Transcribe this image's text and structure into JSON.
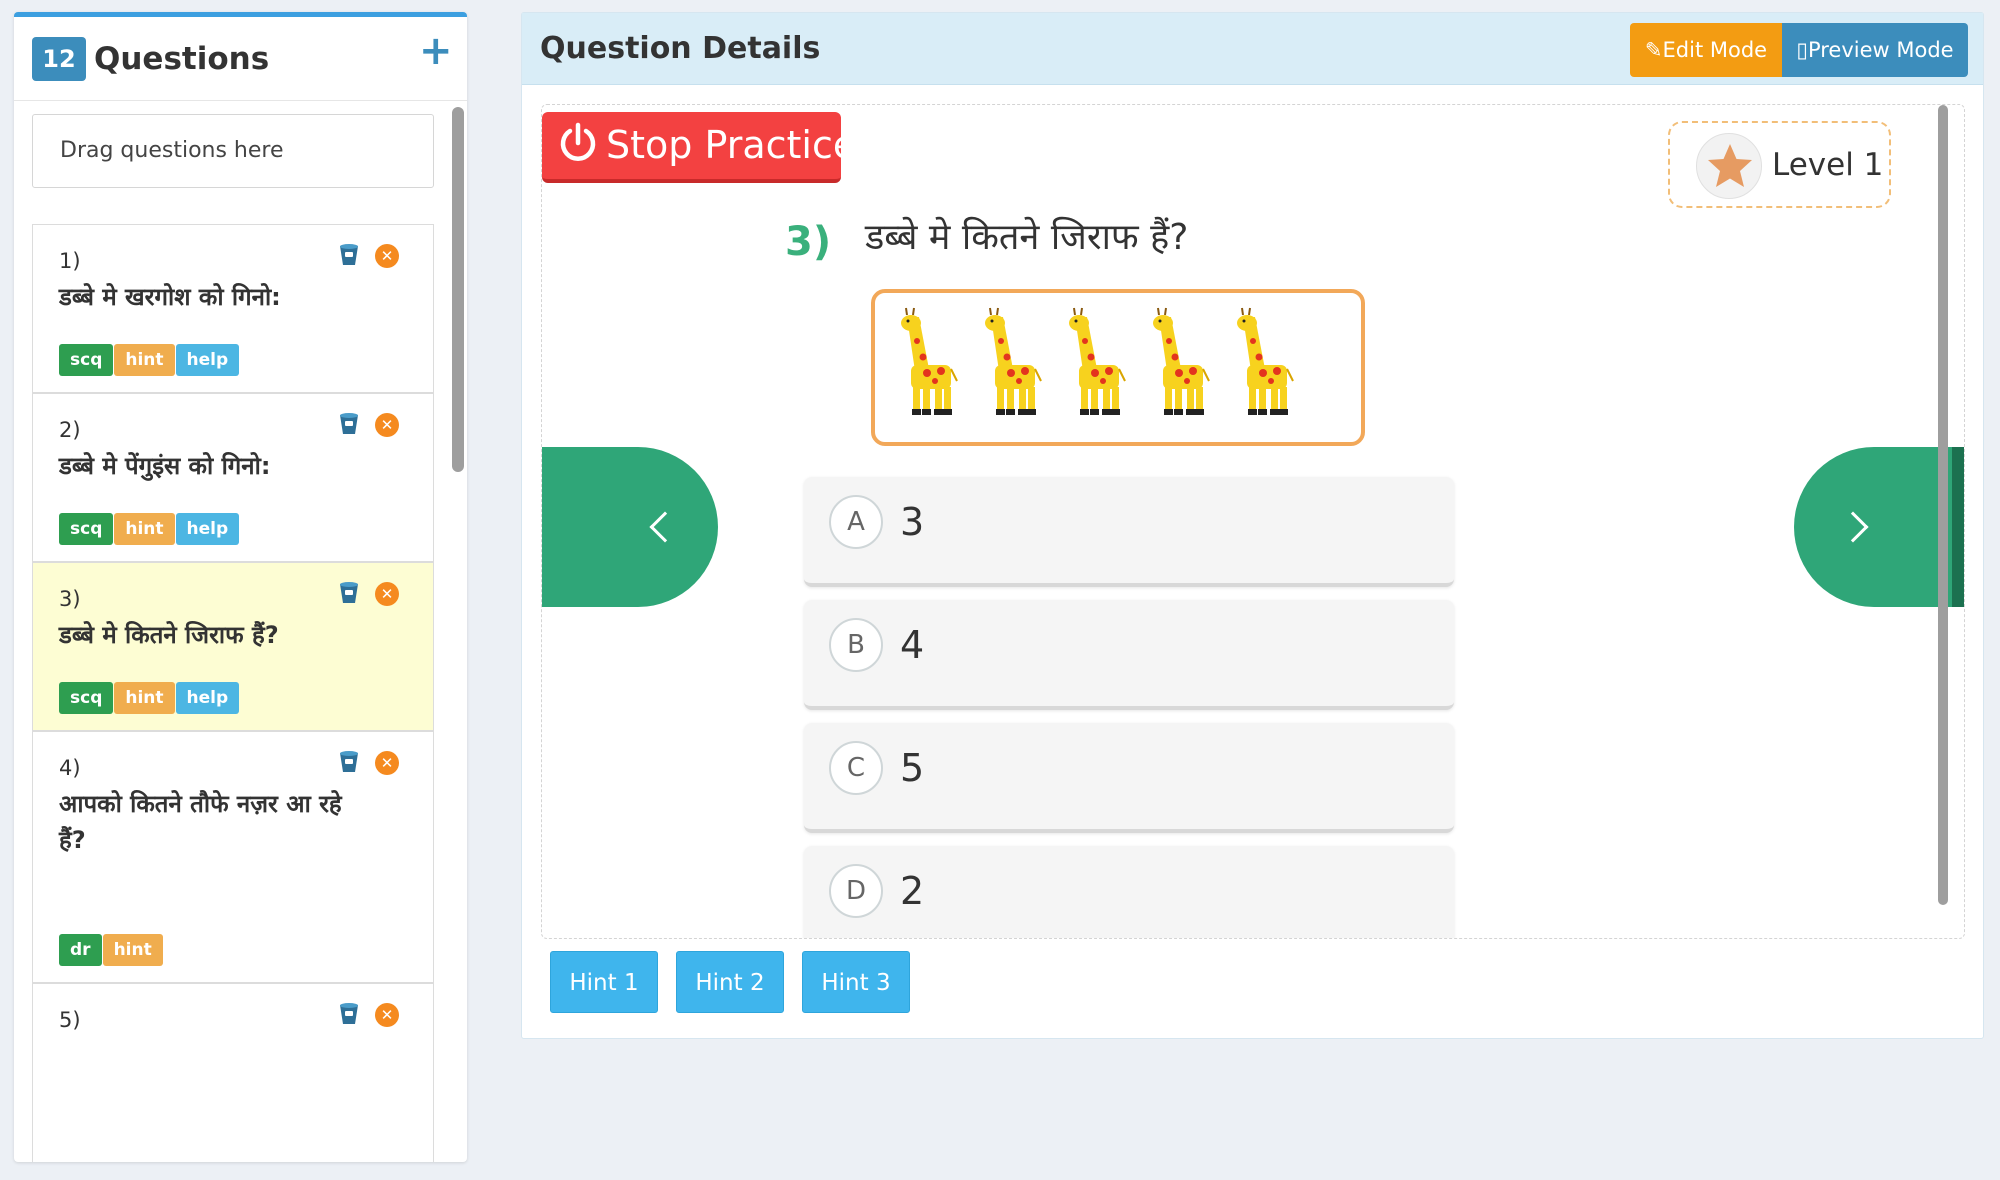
{
  "questions_panel": {
    "count": "12",
    "title": "Questions",
    "add_glyph": "+",
    "drop_placeholder": "Drag questions here",
    "items": [
      {
        "number": "1)",
        "text": "डब्बे मे खरगोश को गिनो:",
        "tags": [
          "scq",
          "hint",
          "help"
        ],
        "active": false
      },
      {
        "number": "2)",
        "text": "डब्बे मे पेंगुइंस को गिनो:",
        "tags": [
          "scq",
          "hint",
          "help"
        ],
        "active": false
      },
      {
        "number": "3)",
        "text": "डब्बे मे कितने जिराफ हैं?",
        "tags": [
          "scq",
          "hint",
          "help"
        ],
        "active": true
      },
      {
        "number": "4)",
        "text": "आपको कितने तौफे नज़र आ रहे हैं?",
        "tags": [
          "dr",
          "hint"
        ],
        "active": false
      },
      {
        "number": "5)",
        "text": "",
        "tags": [],
        "active": false
      }
    ]
  },
  "details": {
    "title": "Question Details",
    "edit_mode_label": "Edit Mode",
    "preview_mode_label": "Preview Mode",
    "stop_label": "Stop Practice",
    "level_label": "Level 1",
    "question_number": "3)",
    "question_text": "डब्बे मे कितने जिराफ हैं?",
    "giraffe_count": 5,
    "options": [
      {
        "letter": "A",
        "value": "3"
      },
      {
        "letter": "B",
        "value": "4"
      },
      {
        "letter": "C",
        "value": "5"
      },
      {
        "letter": "D",
        "value": "2"
      }
    ],
    "hints": [
      "Hint 1",
      "Hint 2",
      "Hint 3"
    ]
  },
  "colors": {
    "primary": "#3c8dbc",
    "edit_orange": "#f39c12",
    "stop_red": "#f34141",
    "nav_green": "#2fa678",
    "question_green": "#3ab07c",
    "active_row": "#fdfdd3",
    "hint_blue": "#3fb5ed"
  },
  "icons": {
    "add": "plus-icon",
    "bucket": "bucket-icon",
    "remove": "remove-icon",
    "edit": "edit-icon",
    "preview": "mobile-icon",
    "stop": "power-icon",
    "level": "star-icon",
    "prev": "chevron-left-icon",
    "next": "chevron-right-icon"
  }
}
